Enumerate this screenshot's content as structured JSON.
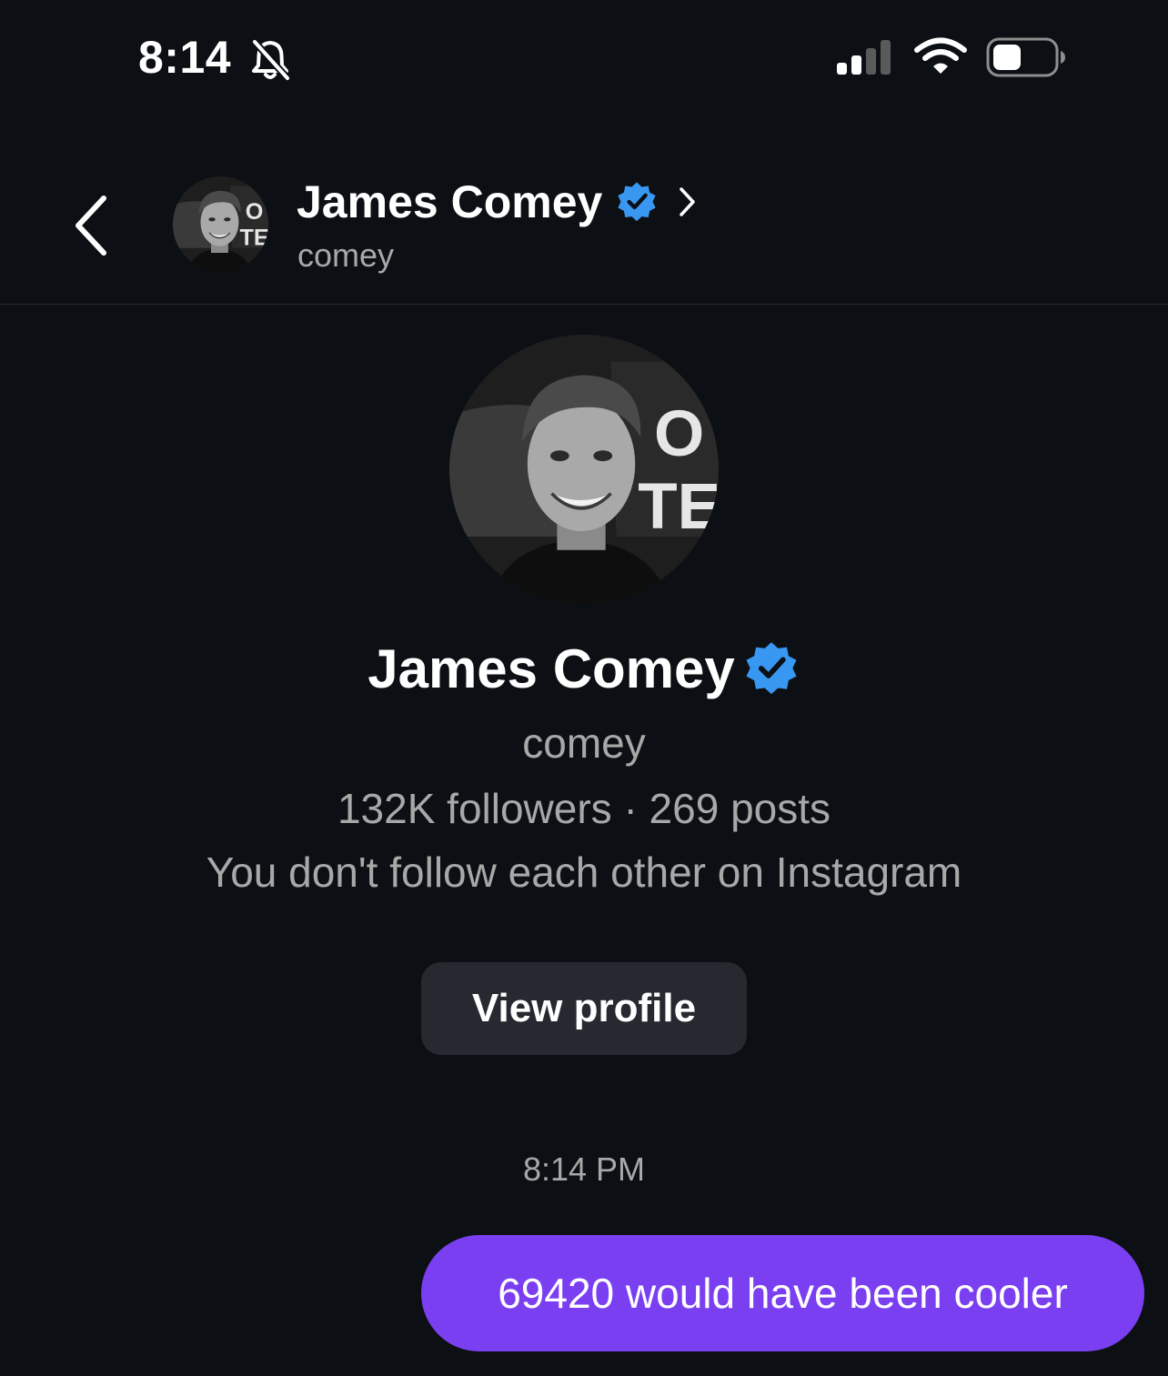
{
  "status_bar": {
    "time": "8:14",
    "icons": [
      "bell-slash-icon",
      "signal-icon",
      "wifi-icon",
      "battery-icon"
    ]
  },
  "header": {
    "back_icon": "chevron-left-icon",
    "name": "James Comey",
    "username": "comey",
    "verified": true,
    "chevron_icon": "chevron-right-icon"
  },
  "profile": {
    "name": "James Comey",
    "username": "comey",
    "stats": "132K followers · 269 posts",
    "follow_note": "You don't follow each other on Instagram",
    "view_profile_label": "View profile"
  },
  "messages": {
    "timestamp": "8:14 PM",
    "items": [
      {
        "sender": "me",
        "text": "69420 would have been cooler"
      }
    ]
  },
  "colors": {
    "background": "#0c1014",
    "bubble": "#7b3ff2",
    "verified": "#3897f0",
    "secondary_text": "#a8a8a8",
    "button": "#262a30"
  }
}
